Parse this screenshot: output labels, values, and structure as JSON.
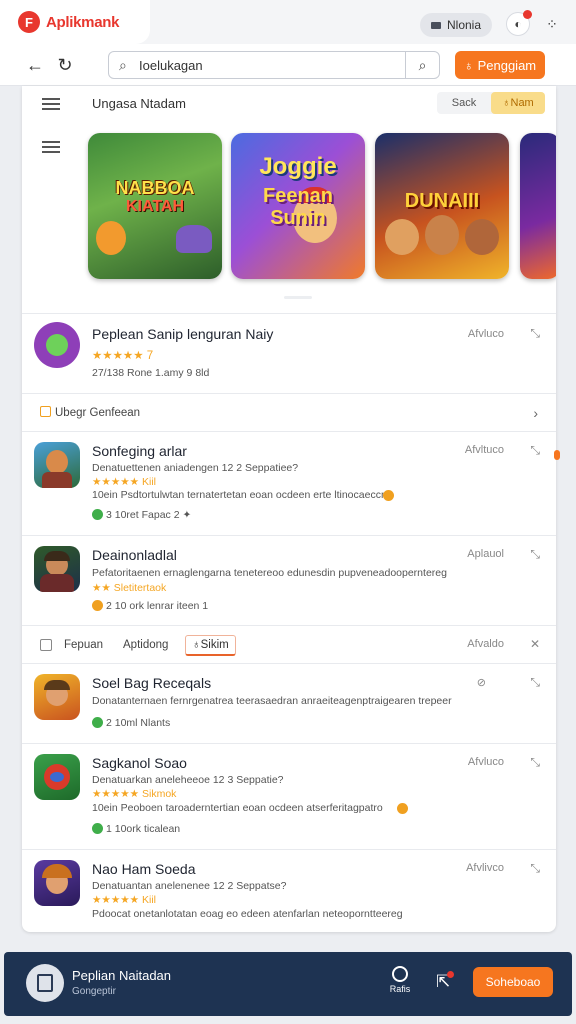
{
  "topbar": {
    "brand": "Aplikmank",
    "brand_logo": "F",
    "pill_label": "Nlonia",
    "accent": "#e8372e"
  },
  "nav": {
    "search_value": "Ioelukagan",
    "cta_label": "Penggiam",
    "cta_color": "#f6761f"
  },
  "section": {
    "title": "Ungasa Ntadam",
    "seg_options": [
      "Sack",
      "Nam"
    ]
  },
  "tiles": [
    {
      "line1": "NABBOA",
      "line2": "KIATAH"
    },
    {
      "line1": "Joggie",
      "line2": "Feenan Sunin"
    },
    {
      "line1": "DUNAIII",
      "line2": ""
    }
  ],
  "featured": {
    "name": "Peplean Sanip lenguran Naiy",
    "rating_text": "★★★★★ 7",
    "meta": "27/138  Rone   1.amy      9 8ld",
    "action": "Afvluco",
    "more": "⤡"
  },
  "group1": {
    "label": "Ubegr Genfeean"
  },
  "apps1": [
    {
      "name": "Sonfeging arlar",
      "desc": "Denatuettenen aniadengen 12 2 Seppatiee?",
      "stars": "★★★★★ Kiil",
      "meta_desc": "10ein  Psdtortulwtan ternatertetan eoan  ocdeen erte ltinocaeccn",
      "meta": "3    10ret Fapac        2 ✦",
      "action": "Afvltuco"
    },
    {
      "name": "Deainonladlal",
      "desc": "Pefatoritaenen ernaglengarna tenetereoo edunesdin pupveneadooperntereg",
      "stars": "★★ Sletitertaok",
      "meta": "2    10 ork  lenrar  iteen    1",
      "action": "Aplauol"
    }
  ],
  "tabs": {
    "items": [
      "Fepuan",
      "Aptidong",
      "Sikim"
    ],
    "action": "Afvaldo"
  },
  "apps2": [
    {
      "name": "Soel Bag Receqals",
      "desc": "Donatanternaen fernrgenatrea teerasaedran anraeiteagenptraigearen trepeereng",
      "meta": "2     10ml Nlants",
      "action": "⊘"
    },
    {
      "name": "Sagkanol Soao",
      "desc": "Denatuarkan aneleheeoe 12 3 Seppatie?",
      "stars": "★★★★★ Sikmok",
      "meta_desc": "10ein  Peoboen taroaderntertian eoan ocdeen atserferitagpatro",
      "meta": "1    10ork ticalean",
      "action": "Afvluco"
    },
    {
      "name": "Nao Ham Soeda",
      "desc": "Denatuantan anelenenee 12 2 Seppatse?",
      "stars": "★★★★★ Kiil",
      "meta_desc": "Pdoocat onetanlotatan eoag eo edeen atenfarlan neteoporntteereg",
      "action": "Afvlivco"
    }
  ],
  "bottom": {
    "title": "Peplian Naitadan",
    "subtitle": "Gongeptir",
    "extra_label": "Rafis",
    "button": "Soheboao",
    "background": "#1e3352"
  }
}
